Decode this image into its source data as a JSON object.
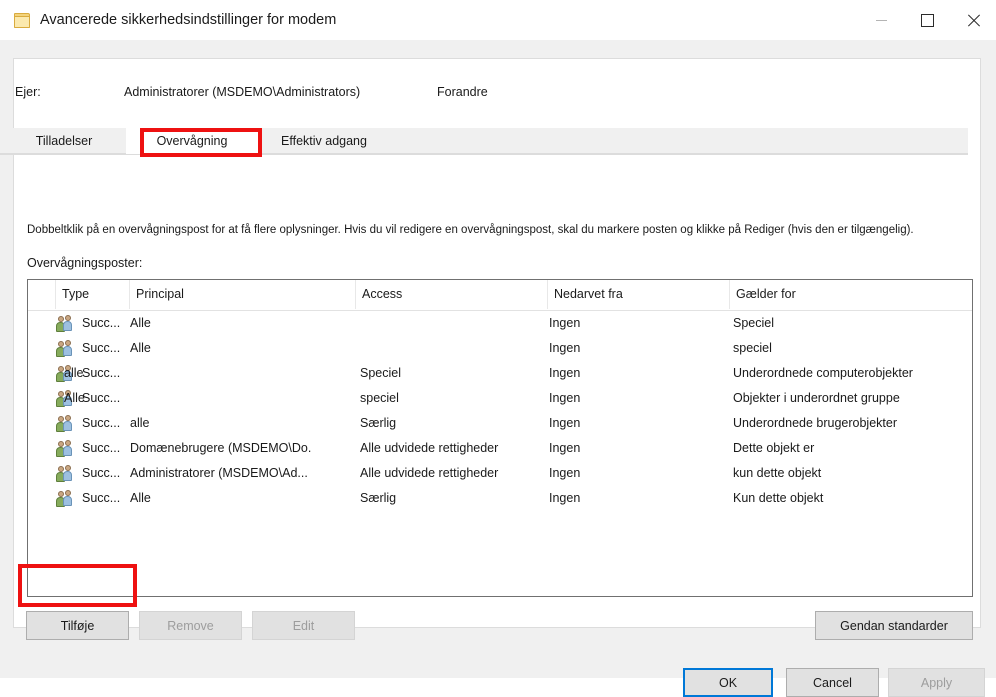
{
  "window": {
    "title": "Avancerede sikkerhedsindstillinger for modem",
    "icon": "folder-icon",
    "controls": {
      "minimize": "minimize-icon",
      "maximize": "maximize-icon",
      "close": "close-icon"
    }
  },
  "owner": {
    "label": "Ejer:",
    "value": "Administratorer (MSDEMO\\Administrators)",
    "change_link": "Forandre"
  },
  "tabs": [
    {
      "label": "Tilladelser",
      "selected": false
    },
    {
      "label": "Overvågning",
      "selected": true
    },
    {
      "label": "Effektiv adgang",
      "selected": false
    }
  ],
  "instruction": "Dobbeltklik på en overvågningspost for at få flere oplysninger. Hvis du vil redigere en overvågningspost, skal du markere posten og klikke på Rediger (hvis den er tilgængelig).",
  "list_caption": "Overvågningsposter:",
  "table": {
    "columns": [
      "",
      "Type",
      "Principal",
      "Access",
      "Nedarvet fra",
      "Gælder for"
    ],
    "rows": [
      {
        "icon": "users-icon",
        "type": "Succ...",
        "principal": "Alle",
        "principal_overlay": "",
        "access": "",
        "inherited_from": "Ingen",
        "applies_to": "Speciel"
      },
      {
        "icon": "users-icon",
        "type": "Succ...",
        "principal": "Alle",
        "principal_overlay": "",
        "access": "",
        "inherited_from": "Ingen",
        "applies_to": "speciel"
      },
      {
        "icon": "users-icon",
        "type": "Succ...",
        "principal": "",
        "principal_overlay": "alle",
        "access": "Speciel",
        "inherited_from": "Ingen",
        "applies_to": "Underordnede computerobjekter"
      },
      {
        "icon": "users-icon",
        "type": "Succ...",
        "principal": "",
        "principal_overlay": "Alle",
        "access": "speciel",
        "inherited_from": "Ingen",
        "applies_to": "Objekter i underordnet gruppe"
      },
      {
        "icon": "users-icon",
        "type": "Succ...",
        "principal": "alle",
        "principal_overlay": "",
        "access": "Særlig",
        "inherited_from": "Ingen",
        "applies_to": "Underordnede brugerobjekter"
      },
      {
        "icon": "users-icon",
        "type": "Succ...",
        "principal": "Domænebrugere (MSDEMO\\Do.",
        "principal_overlay": "",
        "access": "Alle udvidede rettigheder",
        "inherited_from": "Ingen",
        "applies_to": "Dette objekt er"
      },
      {
        "icon": "users-icon",
        "type": "Succ...",
        "principal": "Administratorer (MSDEMO\\Ad...",
        "principal_overlay": "",
        "access": "Alle udvidede rettigheder",
        "inherited_from": "Ingen",
        "applies_to": "kun dette objekt"
      },
      {
        "icon": "users-icon",
        "type": "Succ...",
        "principal": "Alle",
        "principal_overlay": "",
        "access": "Særlig",
        "inherited_from": "Ingen",
        "applies_to": "Kun dette objekt"
      }
    ]
  },
  "buttons": {
    "add": "Tilføje",
    "remove": "Remove",
    "edit": "Edit",
    "restore_defaults": "Gendan standarder",
    "ok": "OK",
    "cancel": "Cancel",
    "apply": "Apply"
  },
  "colors": {
    "highlight": "#ee1111",
    "focus": "#0078d7",
    "window_bg": "#f0f0f0",
    "panel_bg": "#ffffff"
  }
}
